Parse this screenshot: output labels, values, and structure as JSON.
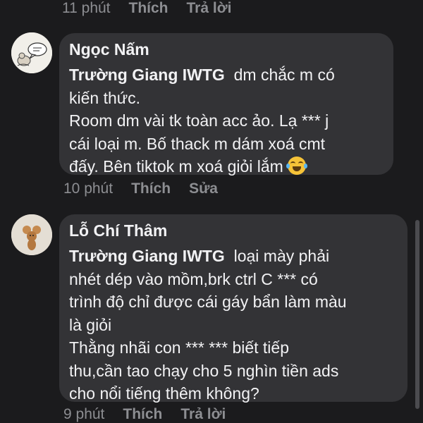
{
  "top_actions": {
    "time": "11 phút",
    "like": "Thích",
    "reply": "Trả lời"
  },
  "comments": [
    {
      "author": "Ngọc Nấm",
      "mention": "Trường Giang IWTG",
      "text": "  dm chắc m có\nkiến thức.\nRoom dm vài tk toàn acc ảo. Lạ *** j\ncái loại m. Bố thack m dám xoá cmt\nđấy. Bên tiktok m xoá giỏi lắm ",
      "emoji": "face-with-tears-of-joy-icon",
      "time": "10 phút",
      "like": "Thích",
      "edit": "Sửa"
    },
    {
      "author": "Lỗ Chí Thâm",
      "mention": "Trường Giang IWTG",
      "text": "  loại mày phải\nnhét dép vào mồm,brk ctrl C *** có\ntrình độ chỉ được cái gáy bẩn làm màu\nlà giỏi\nThằng nhãi con *** *** biết tiếp\nthu,cần tao chạy cho 5 nghìn tiền ads\ncho nổi tiếng thêm không?",
      "time": "9 phút",
      "like": "Thích",
      "reply": "Trả lời"
    }
  ],
  "colors": {
    "background": "#1b1b1d",
    "bubble": "#333336",
    "text": "#f2f2f4",
    "meta": "#8d8e92"
  }
}
